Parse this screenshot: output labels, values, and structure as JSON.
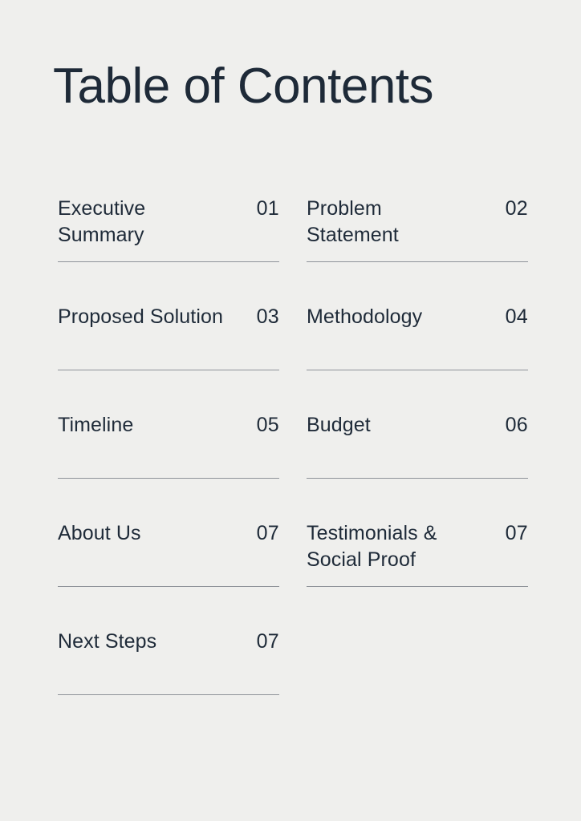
{
  "document": {
    "title": "Table of Contents",
    "background_color": "#efefed",
    "text_color": "#1e2a38",
    "rule_color": "#8e9299"
  },
  "contents": {
    "rows": [
      {
        "left": {
          "label": "Executive Summary",
          "number": "01"
        },
        "right": {
          "label": "Problem Statement",
          "number": "02"
        }
      },
      {
        "left": {
          "label": "Proposed Solution",
          "number": "03"
        },
        "right": {
          "label": "Methodology",
          "number": "04"
        }
      },
      {
        "left": {
          "label": "Timeline",
          "number": "05"
        },
        "right": {
          "label": "Budget",
          "number": "06"
        }
      },
      {
        "left": {
          "label": "About Us",
          "number": "07"
        },
        "right": {
          "label": "Testimonials & Social Proof",
          "number": "07"
        }
      },
      {
        "left": {
          "label": "Next Steps",
          "number": "07"
        },
        "right": {
          "label": "",
          "number": ""
        }
      }
    ]
  }
}
